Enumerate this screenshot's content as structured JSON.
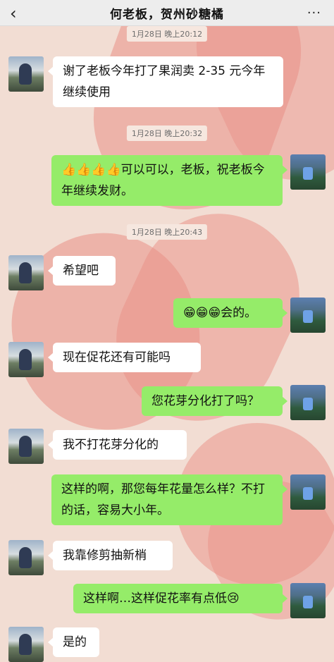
{
  "header": {
    "back_icon": "‹",
    "title": "何老板，贺州砂糖橘",
    "more_icon": "···"
  },
  "messages": [
    {
      "kind": "timestamp",
      "text": "1月28日 晚上20:12"
    },
    {
      "kind": "in",
      "text": "谢了老板今年打了果润卖 2-35 元今年继续使用"
    },
    {
      "kind": "timestamp",
      "text": "1月28日 晚上20:32"
    },
    {
      "kind": "out",
      "emoji": "👍👍👍👍",
      "text": "可以可以，老板，祝老板今年继续发财。"
    },
    {
      "kind": "timestamp",
      "text": "1月28日 晚上20:43"
    },
    {
      "kind": "in",
      "text": "希望吧"
    },
    {
      "kind": "out",
      "emoji": "😁😁😁",
      "text": "会的。"
    },
    {
      "kind": "in",
      "text": "现在促花还有可能吗"
    },
    {
      "kind": "out",
      "text": "您花芽分化打了吗？"
    },
    {
      "kind": "in",
      "text": "我不打花芽分化的"
    },
    {
      "kind": "out",
      "text": "这样的啊，那您每年花量怎么样？不打的话，容易大小年。"
    },
    {
      "kind": "in",
      "text": "我靠修剪抽新梢"
    },
    {
      "kind": "out",
      "text": "这样啊…这样促花率有点低",
      "emoji": "😢"
    },
    {
      "kind": "in",
      "text": "是的"
    }
  ]
}
